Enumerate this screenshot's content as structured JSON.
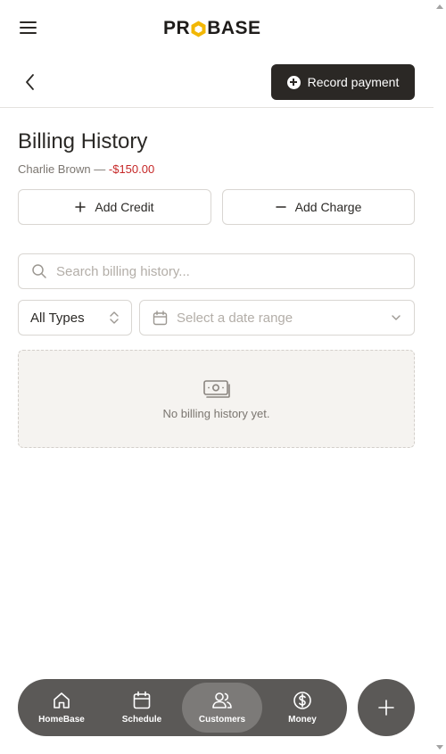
{
  "brand": {
    "logo_left": "PR",
    "logo_right": "BASE"
  },
  "header": {
    "record_payment_label": "Record payment"
  },
  "page": {
    "title": "Billing History",
    "customer_name": "Charlie Brown —",
    "balance": "-$150.00"
  },
  "actions": {
    "add_credit_label": "Add Credit",
    "add_charge_label": "Add Charge"
  },
  "search": {
    "placeholder": "Search billing history..."
  },
  "filters": {
    "type_value": "All Types",
    "date_placeholder": "Select a date range"
  },
  "empty_state": {
    "message": "No billing history yet."
  },
  "bottom_nav": {
    "items": [
      {
        "label": "HomeBase",
        "icon": "home-icon"
      },
      {
        "label": "Schedule",
        "icon": "calendar-icon"
      },
      {
        "label": "Customers",
        "icon": "users-icon",
        "active": true
      },
      {
        "label": "Money",
        "icon": "dollar-circle-icon"
      }
    ]
  },
  "colors": {
    "primary_dark": "#2b2825",
    "accent_yellow": "#f2b705",
    "negative_red": "#c62828",
    "nav_bg": "#5b5957"
  }
}
